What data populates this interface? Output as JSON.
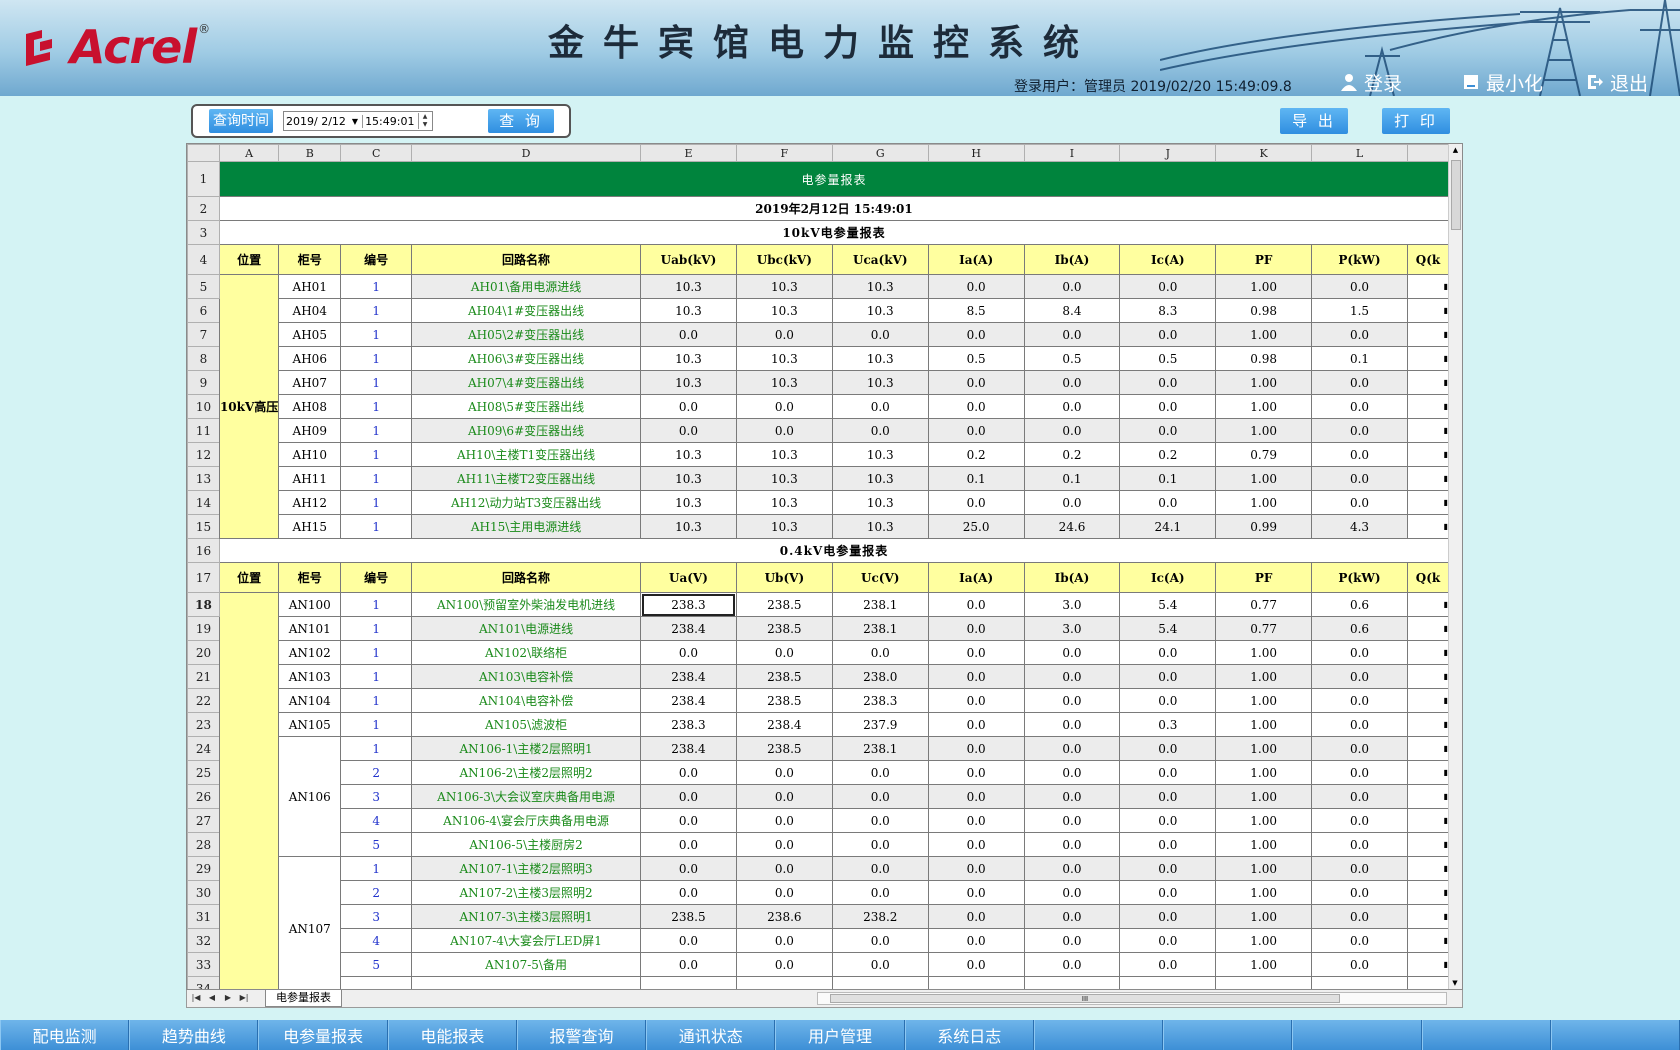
{
  "app": {
    "brand": "Acrel",
    "brand_mark": "®",
    "title": "金牛宾馆电力监控系统",
    "user_info": "登录用户：管理员    2019/02/20  15:49:09.8",
    "buttons": [
      {
        "label": "登录",
        "icon": "user-icon"
      },
      {
        "label": "最小化",
        "icon": "minimize-icon"
      },
      {
        "label": "退出",
        "icon": "exit-icon"
      }
    ]
  },
  "toolbar": {
    "query_time_label": "查询时间",
    "date_value": "2019/ 2/12",
    "time_value": "15:49:01",
    "query_label": "查 询",
    "export_label": "导 出",
    "print_label": "打 印"
  },
  "sheet": {
    "col_letters": [
      "A",
      "B",
      "C",
      "D",
      "E",
      "F",
      "G",
      "H",
      "I",
      "J",
      "K",
      "L"
    ],
    "title": "电参量报表",
    "datetime": "2019年2月12日  15:49:01",
    "section1": "10kV电参量报表",
    "section2": "0.4kV电参量报表",
    "hdr1": [
      "位置",
      "柜号",
      "编号",
      "回路名称",
      "Uab(kV)",
      "Ubc(kV)",
      "Uca(kV)",
      "Ia(A)",
      "Ib(A)",
      "Ic(A)",
      "PF",
      "P(kW)",
      "Q(k"
    ],
    "hdr2": [
      "位置",
      "柜号",
      "编号",
      "回路名称",
      "Ua(V)",
      "Ub(V)",
      "Uc(V)",
      "Ia(A)",
      "Ib(A)",
      "Ic(A)",
      "PF",
      "P(kW)",
      "Q(k"
    ],
    "loc1": "10kV高压",
    "rows1": [
      [
        "AH01",
        "1",
        "AH01\\备用电源进线",
        "10.3",
        "10.3",
        "10.3",
        "0.0",
        "0.0",
        "0.0",
        "1.00",
        "0.0"
      ],
      [
        "AH04",
        "1",
        "AH04\\1#变压器出线",
        "10.3",
        "10.3",
        "10.3",
        "8.5",
        "8.4",
        "8.3",
        "0.98",
        "1.5"
      ],
      [
        "AH05",
        "1",
        "AH05\\2#变压器出线",
        "0.0",
        "0.0",
        "0.0",
        "0.0",
        "0.0",
        "0.0",
        "1.00",
        "0.0"
      ],
      [
        "AH06",
        "1",
        "AH06\\3#变压器出线",
        "10.3",
        "10.3",
        "10.3",
        "0.5",
        "0.5",
        "0.5",
        "0.98",
        "0.1"
      ],
      [
        "AH07",
        "1",
        "AH07\\4#变压器出线",
        "10.3",
        "10.3",
        "10.3",
        "0.0",
        "0.0",
        "0.0",
        "1.00",
        "0.0"
      ],
      [
        "AH08",
        "1",
        "AH08\\5#变压器出线",
        "0.0",
        "0.0",
        "0.0",
        "0.0",
        "0.0",
        "0.0",
        "1.00",
        "0.0"
      ],
      [
        "AH09",
        "1",
        "AH09\\6#变压器出线",
        "0.0",
        "0.0",
        "0.0",
        "0.0",
        "0.0",
        "0.0",
        "1.00",
        "0.0"
      ],
      [
        "AH10",
        "1",
        "AH10\\主楼T1变压器出线",
        "10.3",
        "10.3",
        "10.3",
        "0.2",
        "0.2",
        "0.2",
        "0.79",
        "0.0"
      ],
      [
        "AH11",
        "1",
        "AH11\\主楼T2变压器出线",
        "10.3",
        "10.3",
        "10.3",
        "0.1",
        "0.1",
        "0.1",
        "1.00",
        "0.0"
      ],
      [
        "AH12",
        "1",
        "AH12\\动力站T3变压器出线",
        "10.3",
        "10.3",
        "10.3",
        "0.0",
        "0.0",
        "0.0",
        "1.00",
        "0.0"
      ],
      [
        "AH15",
        "1",
        "AH15\\主用电源进线",
        "10.3",
        "10.3",
        "10.3",
        "25.0",
        "24.6",
        "24.1",
        "0.99",
        "4.3"
      ]
    ],
    "rows2": [
      [
        "AN100",
        "1",
        "AN100\\预留室外柴油发电机进线",
        "238.3",
        "238.5",
        "238.1",
        "0.0",
        "3.0",
        "5.4",
        "0.77",
        "0.6"
      ],
      [
        "AN101",
        "1",
        "AN101\\电源进线",
        "238.4",
        "238.5",
        "238.1",
        "0.0",
        "3.0",
        "5.4",
        "0.77",
        "0.6"
      ],
      [
        "AN102",
        "1",
        "AN102\\联络柜",
        "0.0",
        "0.0",
        "0.0",
        "0.0",
        "0.0",
        "0.0",
        "1.00",
        "0.0"
      ],
      [
        "AN103",
        "1",
        "AN103\\电容补偿",
        "238.4",
        "238.5",
        "238.0",
        "0.0",
        "0.0",
        "0.0",
        "1.00",
        "0.0"
      ],
      [
        "AN104",
        "1",
        "AN104\\电容补偿",
        "238.4",
        "238.5",
        "238.3",
        "0.0",
        "0.0",
        "0.0",
        "1.00",
        "0.0"
      ],
      [
        "AN105",
        "1",
        "AN105\\滤波柜",
        "238.3",
        "238.4",
        "237.9",
        "0.0",
        "0.0",
        "0.3",
        "1.00",
        "0.0"
      ],
      [
        "AN106",
        "1",
        "AN106-1\\主楼2层照明1",
        "238.4",
        "238.5",
        "238.1",
        "0.0",
        "0.0",
        "0.0",
        "1.00",
        "0.0"
      ],
      [
        "AN106",
        "2",
        "AN106-2\\主楼2层照明2",
        "0.0",
        "0.0",
        "0.0",
        "0.0",
        "0.0",
        "0.0",
        "1.00",
        "0.0"
      ],
      [
        "AN106",
        "3",
        "AN106-3\\大会议室庆典备用电源",
        "0.0",
        "0.0",
        "0.0",
        "0.0",
        "0.0",
        "0.0",
        "1.00",
        "0.0"
      ],
      [
        "AN106",
        "4",
        "AN106-4\\宴会厅庆典备用电源",
        "0.0",
        "0.0",
        "0.0",
        "0.0",
        "0.0",
        "0.0",
        "1.00",
        "0.0"
      ],
      [
        "AN106",
        "5",
        "AN106-5\\主楼厨房2",
        "0.0",
        "0.0",
        "0.0",
        "0.0",
        "0.0",
        "0.0",
        "1.00",
        "0.0"
      ],
      [
        "AN107",
        "1",
        "AN107-1\\主楼2层照明3",
        "0.0",
        "0.0",
        "0.0",
        "0.0",
        "0.0",
        "0.0",
        "1.00",
        "0.0"
      ],
      [
        "AN107",
        "2",
        "AN107-2\\主楼3层照明2",
        "0.0",
        "0.0",
        "0.0",
        "0.0",
        "0.0",
        "0.0",
        "1.00",
        "0.0"
      ],
      [
        "AN107",
        "3",
        "AN107-3\\主楼3层照明1",
        "238.5",
        "238.6",
        "238.2",
        "0.0",
        "0.0",
        "0.0",
        "1.00",
        "0.0"
      ],
      [
        "AN107",
        "4",
        "AN107-4\\大宴会厅LED屏1",
        "0.0",
        "0.0",
        "0.0",
        "0.0",
        "0.0",
        "0.0",
        "1.00",
        "0.0"
      ],
      [
        "AN107",
        "5",
        "AN107-5\\备用",
        "0.0",
        "0.0",
        "0.0",
        "0.0",
        "0.0",
        "0.0",
        "1.00",
        "0.0"
      ]
    ],
    "tab_label": "电参量报表",
    "hscroll_grip": "III"
  },
  "nav": [
    "配电监测",
    "趋势曲线",
    "电参量报表",
    "电能报表",
    "报警查询",
    "通讯状态",
    "用户管理",
    "系统日志",
    "",
    "",
    "",
    "",
    ""
  ],
  "colors": {
    "title_green": "#00843d",
    "header_yellow": "#ffff9f",
    "nav_blue": "#3d8fd6",
    "brand_red": "#c8102e"
  }
}
